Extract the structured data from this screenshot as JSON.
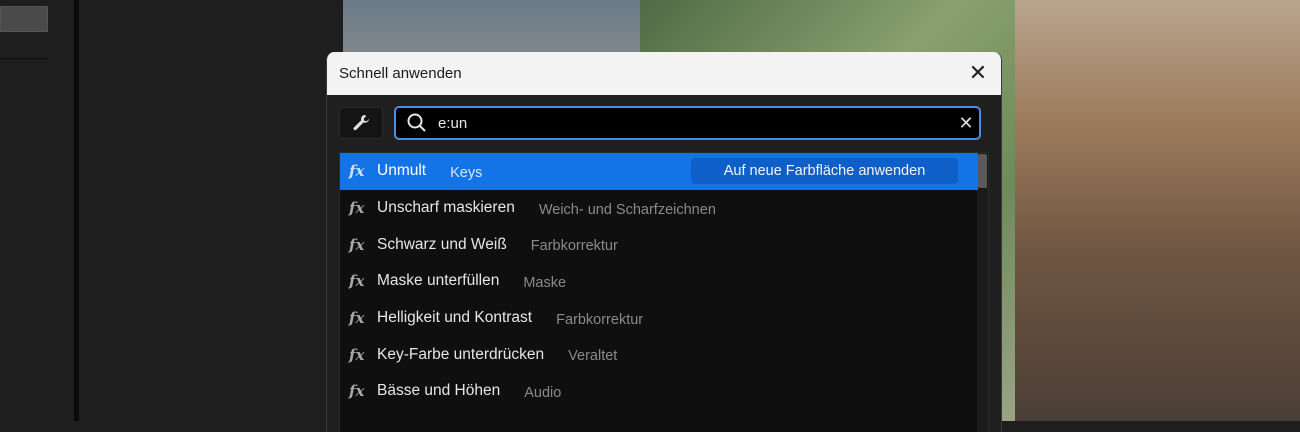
{
  "dialog": {
    "title": "Schnell anwenden",
    "search": {
      "value": "e:un"
    },
    "apply_button": "Auf neue Farbfläche anwenden",
    "results": [
      {
        "name": "Unmult",
        "category": "Keys",
        "selected": true
      },
      {
        "name": "Unscharf maskieren",
        "category": "Weich- und Scharfzeichnen"
      },
      {
        "name": "Schwarz und Weiß",
        "category": "Farbkorrektur"
      },
      {
        "name": "Maske unterfüllen",
        "category": "Maske"
      },
      {
        "name": "Helligkeit und Kontrast",
        "category": "Farbkorrektur"
      },
      {
        "name": "Key-Farbe unterdrücken",
        "category": "Veraltet"
      },
      {
        "name": "Bässe und Höhen",
        "category": "Audio"
      }
    ],
    "fx_label": "fx"
  },
  "colors": {
    "accent": "#1473e6",
    "focus": "#4a8fd8"
  }
}
